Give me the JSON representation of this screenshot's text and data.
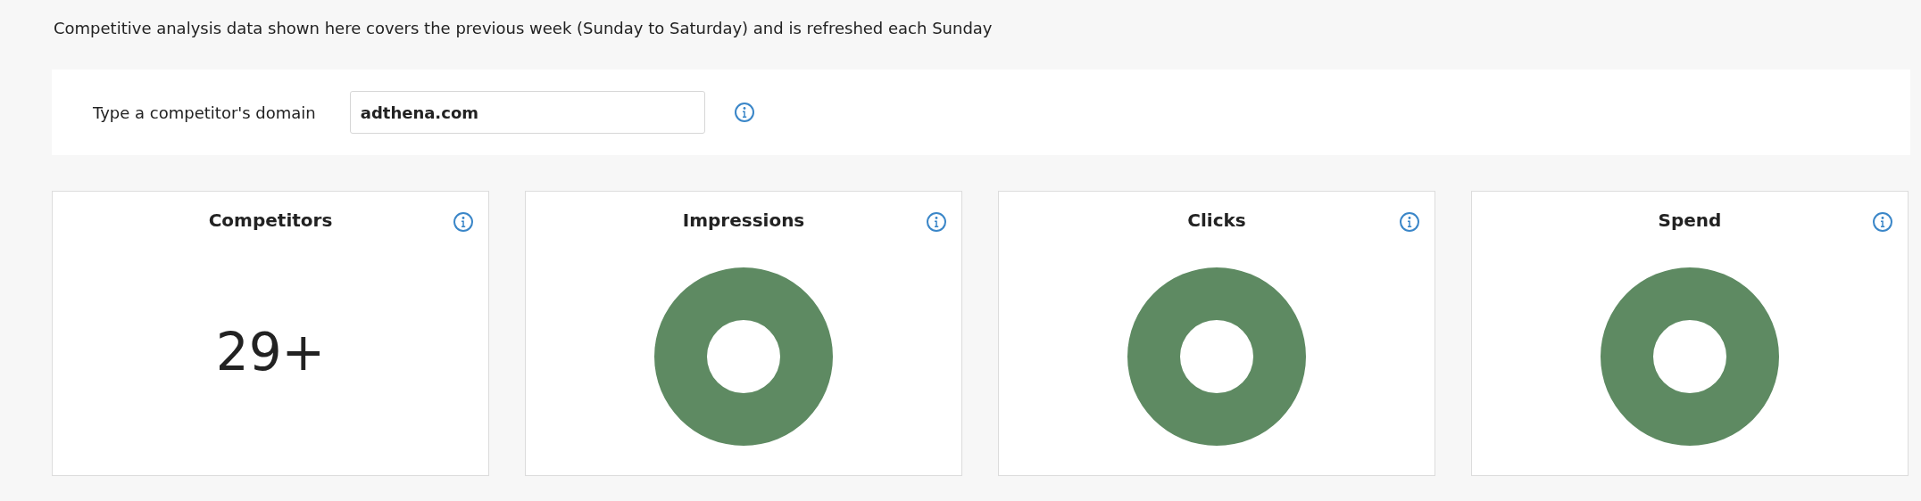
{
  "notice": "Competitive analysis data shown here covers the previous week (Sunday to Saturday) and is refreshed each Sunday",
  "domain_search": {
    "label": "Type a competitor's domain",
    "value": "adthena.com"
  },
  "cards": [
    {
      "title": "Competitors",
      "kind": "number",
      "value": "29+"
    },
    {
      "title": "Impressions",
      "kind": "donut"
    },
    {
      "title": "Clicks",
      "kind": "donut"
    },
    {
      "title": "Spend",
      "kind": "donut"
    }
  ]
}
